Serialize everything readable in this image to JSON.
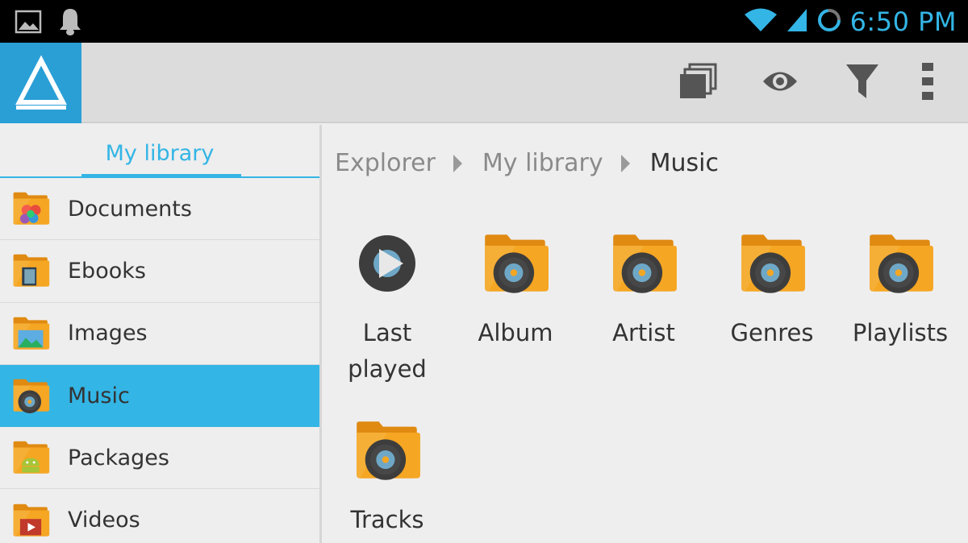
{
  "status_bar": {
    "left_icons": [
      "gallery-icon",
      "notification-bell-icon"
    ],
    "right_icons": [
      "wifi-icon",
      "signal-icon",
      "sync-circle-icon"
    ],
    "time": "6:50 PM"
  },
  "action_bar": {
    "logo_icon": "app-triangle-logo-icon",
    "actions": [
      {
        "name": "windows",
        "icon": "stacked-windows-icon"
      },
      {
        "name": "view",
        "icon": "eye-icon"
      },
      {
        "name": "filter",
        "icon": "filter-funnel-icon"
      },
      {
        "name": "more",
        "icon": "overflow-menu-icon"
      }
    ]
  },
  "sidebar": {
    "tab_label": "My library",
    "items": [
      {
        "label": "Documents",
        "icon": "documents-folder-icon",
        "selected": false
      },
      {
        "label": "Ebooks",
        "icon": "ebooks-folder-icon",
        "selected": false
      },
      {
        "label": "Images",
        "icon": "images-folder-icon",
        "selected": false
      },
      {
        "label": "Music",
        "icon": "music-folder-icon",
        "selected": true
      },
      {
        "label": "Packages",
        "icon": "packages-folder-icon",
        "selected": false
      },
      {
        "label": "Videos",
        "icon": "videos-folder-icon",
        "selected": false
      }
    ]
  },
  "breadcrumb": {
    "items": [
      "Explorer",
      "My library",
      "Music"
    ]
  },
  "grid": {
    "items": [
      {
        "label": "Last played",
        "icon": "play-circle-icon"
      },
      {
        "label": "Album",
        "icon": "music-folder-icon"
      },
      {
        "label": "Artist",
        "icon": "music-folder-icon"
      },
      {
        "label": "Genres",
        "icon": "music-folder-icon"
      },
      {
        "label": "Playlists",
        "icon": "music-folder-icon"
      },
      {
        "label": "Tracks",
        "icon": "music-folder-icon"
      }
    ]
  },
  "colors": {
    "accent": "#33b5e5",
    "logo_bg": "#2a9fd6",
    "folder": "#f5a623",
    "folder_dark": "#e08a12",
    "disc": "#3d3d3d"
  }
}
